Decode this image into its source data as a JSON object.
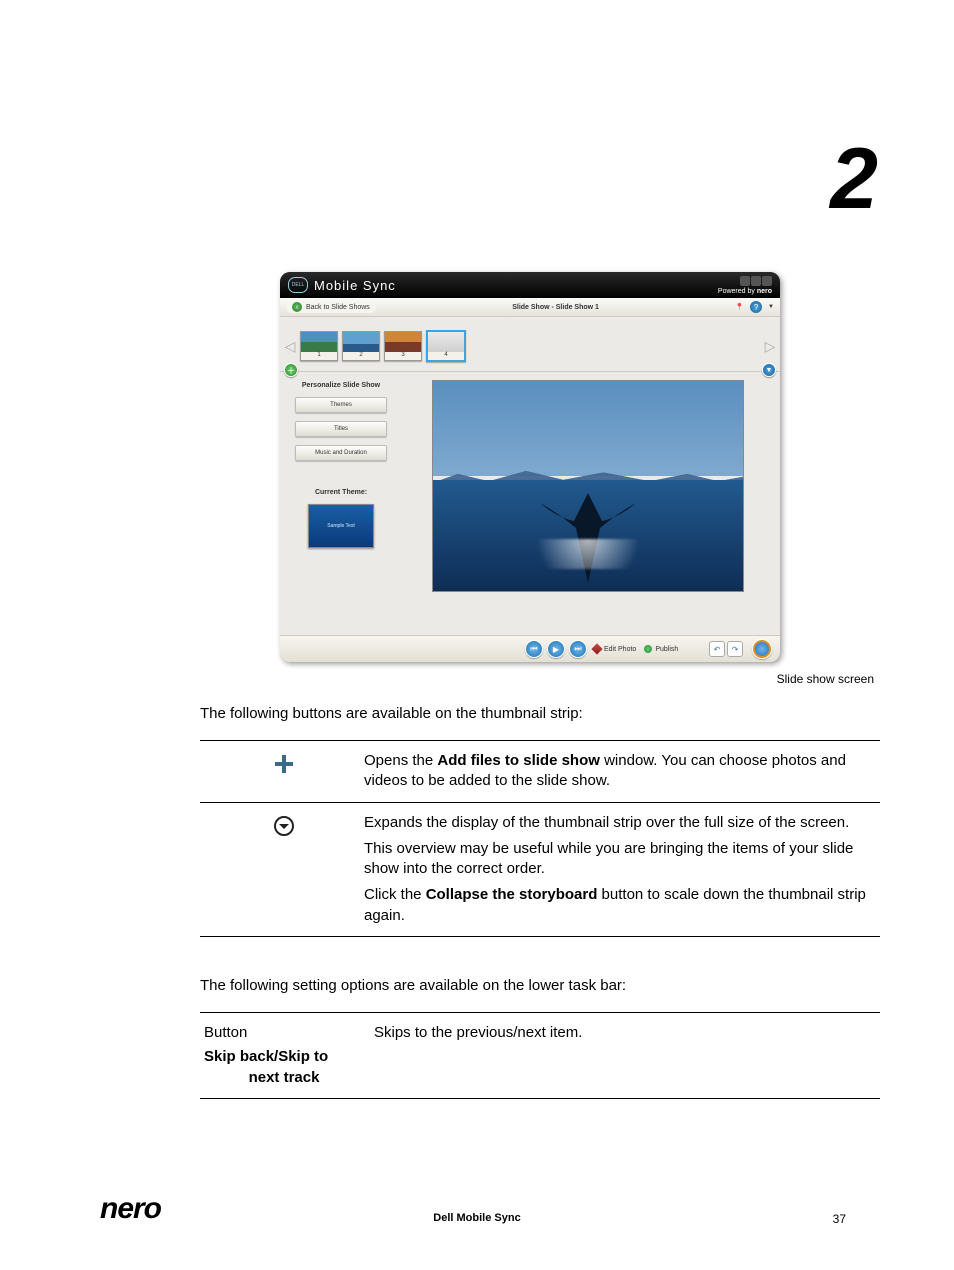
{
  "chapter_number": "2",
  "screenshot": {
    "app_title": "Mobile Sync",
    "logo_text": "DELL",
    "powered_by_prefix": "Powered by ",
    "powered_by_brand": "nero",
    "back_label": "Back to Slide Shows",
    "breadcrumb": "Slide Show - Slide Show 1",
    "thumbs": [
      "1",
      "2",
      "3",
      "4"
    ],
    "side": {
      "title": "Personalize Slide Show",
      "btn_themes": "Themes",
      "btn_titles": "Titles",
      "btn_music": "Music and Duration",
      "current_theme_label": "Current Theme:",
      "sample_text": "Sample Text"
    },
    "taskbar": {
      "edit_photo": "Edit Photo",
      "publish": "Publish"
    }
  },
  "caption": "Slide show screen",
  "para1": "The following buttons are available on the thumbnail strip:",
  "table1": {
    "row1": {
      "seg_a": "Opens the ",
      "bold": "Add files to slide show",
      "seg_b": " window. You can choose photos and videos to be added to the slide show."
    },
    "row2": {
      "p1": "Expands the display of the thumbnail strip over the full size of the screen.",
      "p2": "This overview may be useful while you are bringing the items of your slide show into the correct order.",
      "p3_a": "Click the ",
      "p3_bold": "Collapse the storyboard",
      "p3_b": " button to scale down the thumbnail strip again."
    }
  },
  "para2": "The following setting options are available on the lower task bar:",
  "table2": {
    "label_top": "Button",
    "label_bold1": "Skip back/Skip to",
    "label_bold2": "next track",
    "desc": "Skips to the previous/next item."
  },
  "footer": {
    "brand": "nero",
    "title": "Dell Mobile Sync",
    "page": "37"
  }
}
